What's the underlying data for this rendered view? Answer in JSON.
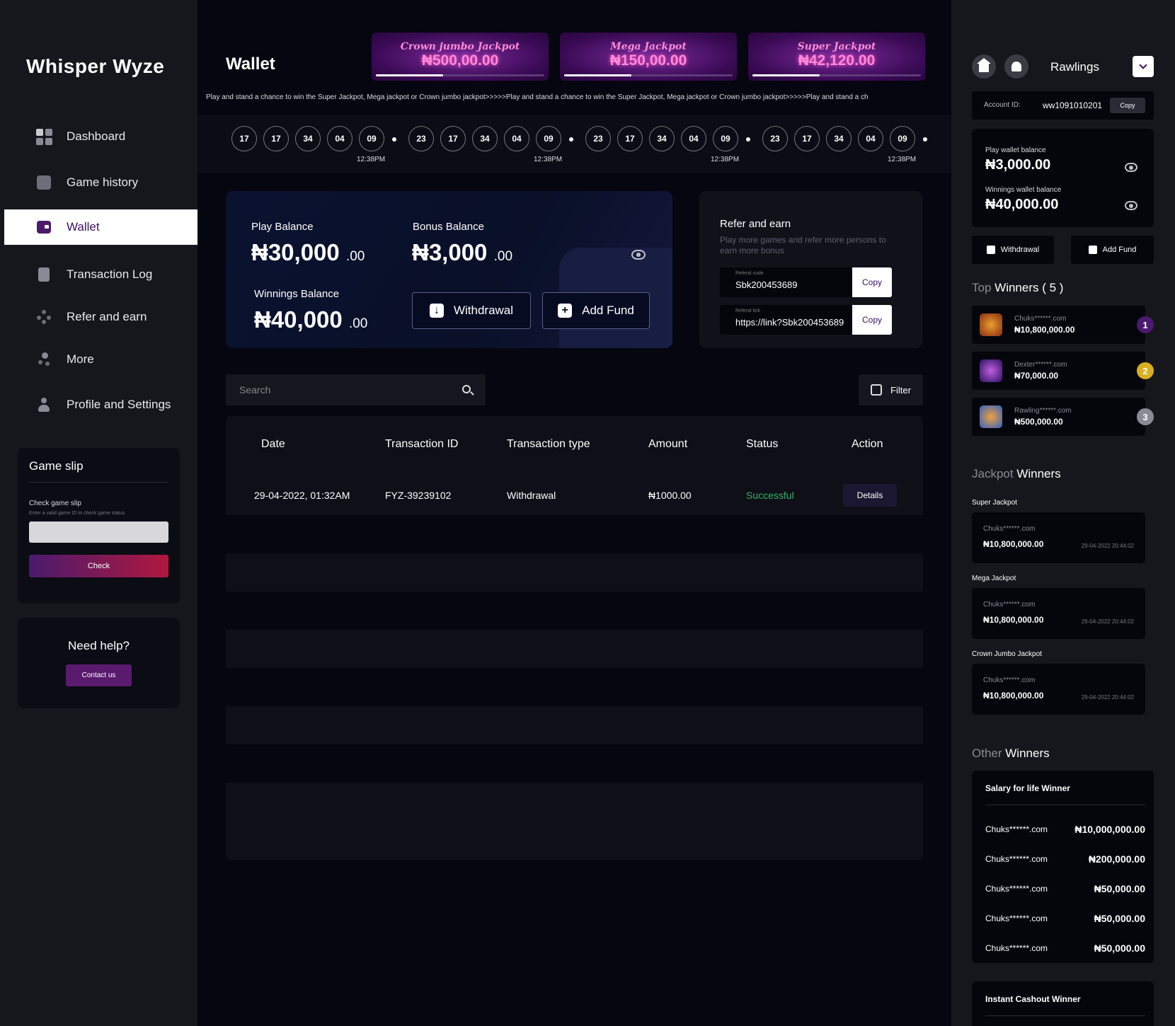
{
  "app": {
    "logo": "Whisper Wyze"
  },
  "sidebar": {
    "items": [
      {
        "label": "Dashboard"
      },
      {
        "label": "Game history"
      },
      {
        "label": "Wallet"
      },
      {
        "label": "Transaction Log"
      },
      {
        "label": "Refer and earn"
      },
      {
        "label": "More"
      },
      {
        "label": "Profile and Settings"
      }
    ],
    "game_slip": {
      "title": "Game slip",
      "subtitle": "Check game slip",
      "hint": "Enter a valid game ID to check game status",
      "input_placeholder": "",
      "button": "Check"
    },
    "help": {
      "title": "Need  help?",
      "button": "Contact us"
    }
  },
  "header": {
    "page_title": "Wallet",
    "jackpots": [
      {
        "name": "Crown jumbo Jackpot",
        "amount": "₦500,00.00",
        "progress": 0.4
      },
      {
        "name": "Mega Jackpot",
        "amount": "₦150,00.00",
        "progress": 0.4
      },
      {
        "name": "Super Jackpot",
        "amount": "₦42,120.00",
        "progress": 0.4
      }
    ],
    "ticker": "Play and stand a chance to win the Super Jackpot, Mega jackpot or Crown jumbo jackpot>>>>>Play and stand a chance to win the Super Jackpot, Mega jackpot or Crown jumbo jackpot>>>>>Play and stand a ch",
    "draws": [
      {
        "balls": [
          "17",
          "17",
          "34",
          "04",
          "09"
        ],
        "time": "12:38PM"
      },
      {
        "balls": [
          "23",
          "17",
          "34",
          "04",
          "09"
        ],
        "time": "12:38PM"
      },
      {
        "balls": [
          "23",
          "17",
          "34",
          "04",
          "09"
        ],
        "time": "12:38PM"
      },
      {
        "balls": [
          "23",
          "17",
          "34",
          "04",
          "09"
        ],
        "time": "12:38PM"
      }
    ]
  },
  "balances": {
    "play": {
      "label": "Play Balance",
      "whole": "₦30,000",
      "decimal": ".00"
    },
    "bonus": {
      "label": "Bonus Balance",
      "whole": "₦3,000",
      "decimal": ".00"
    },
    "winnings": {
      "label": "Winnings Balance",
      "whole": "₦40,000",
      "decimal": ".00"
    },
    "withdrawal_btn": "Withdrawal",
    "add_fund_btn": "Add Fund"
  },
  "refer": {
    "title": "Refer and earn",
    "subtitle": "Play more games and refer more persons to earn more bonus",
    "code_label": "Referal code",
    "code": "Sbk200453689",
    "link_label": "Referal link",
    "link": "https://link?Sbk200453689",
    "copy": "Copy"
  },
  "search": {
    "placeholder": "Search"
  },
  "filter": {
    "label": "Filter"
  },
  "table": {
    "headers": [
      "Date",
      "Transaction ID",
      "Transaction type",
      "Amount",
      "Status",
      "Action"
    ],
    "rows": [
      {
        "date": "29-04-2022, 01:32AM",
        "id": "FYZ-39239102",
        "type": "Withdrawal",
        "amount": "₦1000.00",
        "status": "Successful",
        "action": "Details"
      }
    ]
  },
  "right": {
    "user": "Rawlings",
    "account": {
      "label": "Account ID:",
      "id": "ww1091010201",
      "copy": "Copy"
    },
    "play_wallet": {
      "label": "Play wallet balance",
      "amount": "₦3,000.00"
    },
    "winnings_wallet": {
      "label": "Winnings wallet balance",
      "amount": "₦40,000.00"
    },
    "withdrawal": "Withdrawal",
    "add_fund": "Add Fund",
    "top_winners": {
      "title_dim": "Top",
      "title": "Winners",
      "count": "( 5 )",
      "list": [
        {
          "name": "Chuks******.com",
          "amount": "₦10,800,000.00",
          "rank": "1"
        },
        {
          "name": "Dexter******.com",
          "amount": "₦70,000.00",
          "rank": "2"
        },
        {
          "name": "Rawling******.com",
          "amount": "₦500,000.00",
          "rank": "3"
        }
      ]
    },
    "jackpot_winners": {
      "title_dim": "Jackpot",
      "title": "Winners",
      "list": [
        {
          "label": "Super Jackpot",
          "name": "Chuks******.com",
          "amount": "₦10,800,000.00",
          "date": "29-04-2022 20:44:02"
        },
        {
          "label": "Mega Jackpot",
          "name": "Chuks******.com",
          "amount": "₦10,800,000.00",
          "date": "29-04-2022 20:44:02"
        },
        {
          "label": "Crown Jumbo Jackpot",
          "name": "Chuks******.com",
          "amount": "₦10,800,000.00",
          "date": "29-04-2022 20:44:02"
        }
      ]
    },
    "other_winners": {
      "title_dim": "Other",
      "title": "Winners",
      "card_title": "Salary for life Winner",
      "list": [
        {
          "name": "Chuks******.com",
          "amount": "₦10,000,000.00"
        },
        {
          "name": "Chuks******.com",
          "amount": "₦200,000.00"
        },
        {
          "name": "Chuks******.com",
          "amount": "₦50,000.00"
        },
        {
          "name": "Chuks******.com",
          "amount": "₦50,000.00"
        },
        {
          "name": "Chuks******.com",
          "amount": "₦50,000.00"
        }
      ]
    },
    "instant": {
      "title": "Instant Cashout Winner"
    }
  },
  "colors": {
    "accent": "#5a1a6e",
    "success": "#2db36a",
    "jackpot_text": "#ff8ad8"
  }
}
